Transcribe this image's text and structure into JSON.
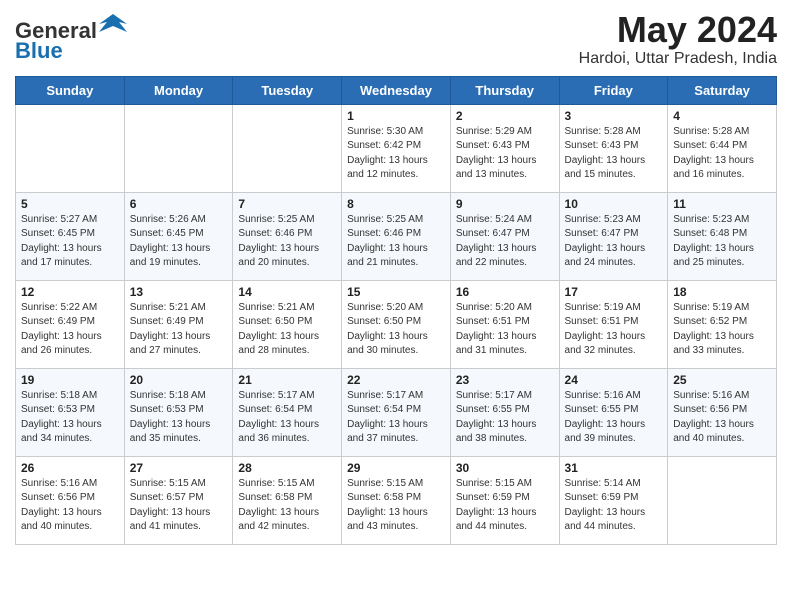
{
  "header": {
    "logo_line1": "General",
    "logo_line2": "Blue",
    "month_year": "May 2024",
    "location": "Hardoi, Uttar Pradesh, India"
  },
  "weekdays": [
    "Sunday",
    "Monday",
    "Tuesday",
    "Wednesday",
    "Thursday",
    "Friday",
    "Saturday"
  ],
  "weeks": [
    [
      {
        "day": "",
        "info": ""
      },
      {
        "day": "",
        "info": ""
      },
      {
        "day": "",
        "info": ""
      },
      {
        "day": "1",
        "info": "Sunrise: 5:30 AM\nSunset: 6:42 PM\nDaylight: 13 hours\nand 12 minutes."
      },
      {
        "day": "2",
        "info": "Sunrise: 5:29 AM\nSunset: 6:43 PM\nDaylight: 13 hours\nand 13 minutes."
      },
      {
        "day": "3",
        "info": "Sunrise: 5:28 AM\nSunset: 6:43 PM\nDaylight: 13 hours\nand 15 minutes."
      },
      {
        "day": "4",
        "info": "Sunrise: 5:28 AM\nSunset: 6:44 PM\nDaylight: 13 hours\nand 16 minutes."
      }
    ],
    [
      {
        "day": "5",
        "info": "Sunrise: 5:27 AM\nSunset: 6:45 PM\nDaylight: 13 hours\nand 17 minutes."
      },
      {
        "day": "6",
        "info": "Sunrise: 5:26 AM\nSunset: 6:45 PM\nDaylight: 13 hours\nand 19 minutes."
      },
      {
        "day": "7",
        "info": "Sunrise: 5:25 AM\nSunset: 6:46 PM\nDaylight: 13 hours\nand 20 minutes."
      },
      {
        "day": "8",
        "info": "Sunrise: 5:25 AM\nSunset: 6:46 PM\nDaylight: 13 hours\nand 21 minutes."
      },
      {
        "day": "9",
        "info": "Sunrise: 5:24 AM\nSunset: 6:47 PM\nDaylight: 13 hours\nand 22 minutes."
      },
      {
        "day": "10",
        "info": "Sunrise: 5:23 AM\nSunset: 6:47 PM\nDaylight: 13 hours\nand 24 minutes."
      },
      {
        "day": "11",
        "info": "Sunrise: 5:23 AM\nSunset: 6:48 PM\nDaylight: 13 hours\nand 25 minutes."
      }
    ],
    [
      {
        "day": "12",
        "info": "Sunrise: 5:22 AM\nSunset: 6:49 PM\nDaylight: 13 hours\nand 26 minutes."
      },
      {
        "day": "13",
        "info": "Sunrise: 5:21 AM\nSunset: 6:49 PM\nDaylight: 13 hours\nand 27 minutes."
      },
      {
        "day": "14",
        "info": "Sunrise: 5:21 AM\nSunset: 6:50 PM\nDaylight: 13 hours\nand 28 minutes."
      },
      {
        "day": "15",
        "info": "Sunrise: 5:20 AM\nSunset: 6:50 PM\nDaylight: 13 hours\nand 30 minutes."
      },
      {
        "day": "16",
        "info": "Sunrise: 5:20 AM\nSunset: 6:51 PM\nDaylight: 13 hours\nand 31 minutes."
      },
      {
        "day": "17",
        "info": "Sunrise: 5:19 AM\nSunset: 6:51 PM\nDaylight: 13 hours\nand 32 minutes."
      },
      {
        "day": "18",
        "info": "Sunrise: 5:19 AM\nSunset: 6:52 PM\nDaylight: 13 hours\nand 33 minutes."
      }
    ],
    [
      {
        "day": "19",
        "info": "Sunrise: 5:18 AM\nSunset: 6:53 PM\nDaylight: 13 hours\nand 34 minutes."
      },
      {
        "day": "20",
        "info": "Sunrise: 5:18 AM\nSunset: 6:53 PM\nDaylight: 13 hours\nand 35 minutes."
      },
      {
        "day": "21",
        "info": "Sunrise: 5:17 AM\nSunset: 6:54 PM\nDaylight: 13 hours\nand 36 minutes."
      },
      {
        "day": "22",
        "info": "Sunrise: 5:17 AM\nSunset: 6:54 PM\nDaylight: 13 hours\nand 37 minutes."
      },
      {
        "day": "23",
        "info": "Sunrise: 5:17 AM\nSunset: 6:55 PM\nDaylight: 13 hours\nand 38 minutes."
      },
      {
        "day": "24",
        "info": "Sunrise: 5:16 AM\nSunset: 6:55 PM\nDaylight: 13 hours\nand 39 minutes."
      },
      {
        "day": "25",
        "info": "Sunrise: 5:16 AM\nSunset: 6:56 PM\nDaylight: 13 hours\nand 40 minutes."
      }
    ],
    [
      {
        "day": "26",
        "info": "Sunrise: 5:16 AM\nSunset: 6:56 PM\nDaylight: 13 hours\nand 40 minutes."
      },
      {
        "day": "27",
        "info": "Sunrise: 5:15 AM\nSunset: 6:57 PM\nDaylight: 13 hours\nand 41 minutes."
      },
      {
        "day": "28",
        "info": "Sunrise: 5:15 AM\nSunset: 6:58 PM\nDaylight: 13 hours\nand 42 minutes."
      },
      {
        "day": "29",
        "info": "Sunrise: 5:15 AM\nSunset: 6:58 PM\nDaylight: 13 hours\nand 43 minutes."
      },
      {
        "day": "30",
        "info": "Sunrise: 5:15 AM\nSunset: 6:59 PM\nDaylight: 13 hours\nand 44 minutes."
      },
      {
        "day": "31",
        "info": "Sunrise: 5:14 AM\nSunset: 6:59 PM\nDaylight: 13 hours\nand 44 minutes."
      },
      {
        "day": "",
        "info": ""
      }
    ]
  ]
}
